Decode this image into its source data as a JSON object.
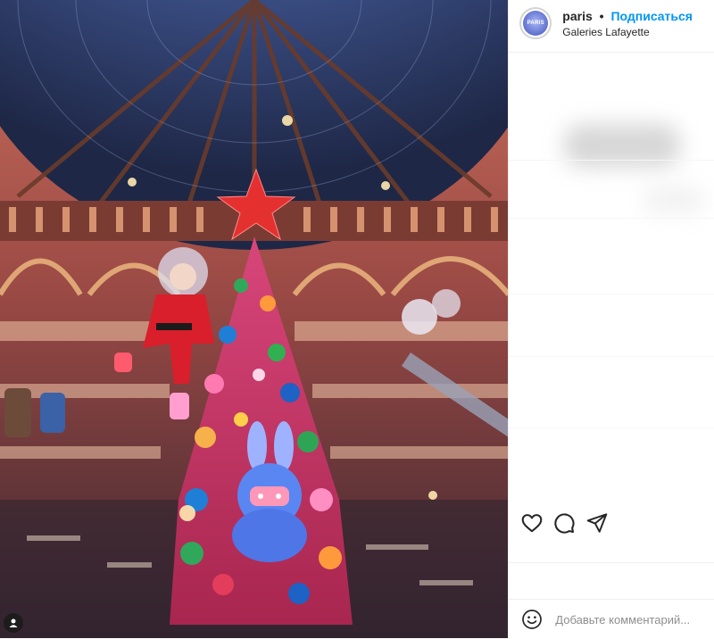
{
  "post": {
    "media": {
      "description_icon": "christmas-tree-photo",
      "tag_icon": "user-tag-icon"
    },
    "header": {
      "username": "paris",
      "separator": "•",
      "follow_label": "Подписаться",
      "location": "Galeries Lafayette",
      "avatar_text": "PARIS"
    },
    "actions": {
      "like_icon": "heart-icon",
      "comment_icon": "comment-bubble-icon",
      "share_icon": "paper-plane-icon"
    },
    "comment_box": {
      "emoji_icon": "smiley-icon",
      "placeholder": "Добавьте комментарий..."
    },
    "colors": {
      "accent": "#0095f6",
      "text": "#262626",
      "muted": "#8e8e8e",
      "border": "#efefef"
    }
  }
}
